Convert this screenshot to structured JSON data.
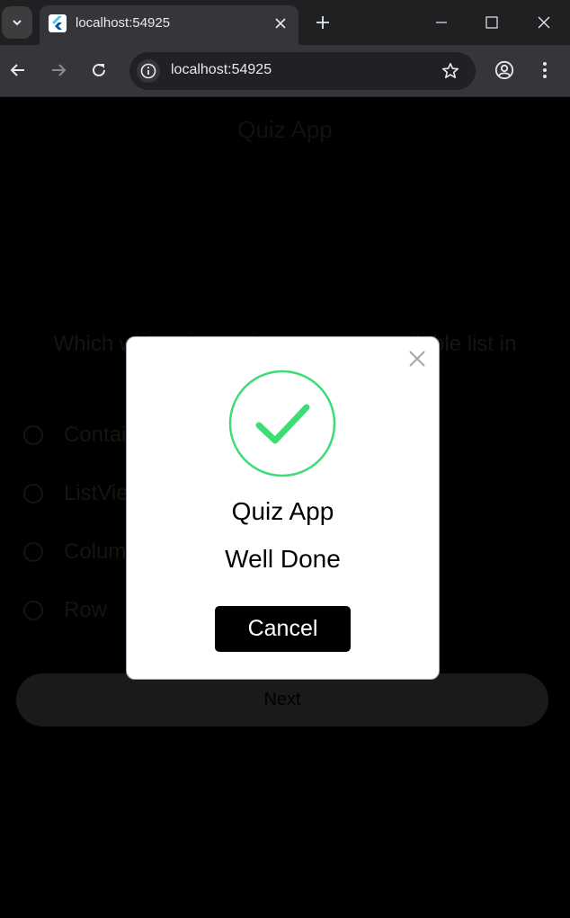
{
  "browser": {
    "tab_title": "localhost:54925",
    "url": "localhost:54925"
  },
  "app": {
    "title": "Quiz App",
    "question": "Which widget is used to create a scrollable list in",
    "options": [
      "Container",
      "ListView",
      "Column",
      "Row"
    ],
    "next_label": "Next"
  },
  "dialog": {
    "icon": "check-circle-icon",
    "title": "Quiz App",
    "message": "Well Done",
    "cancel_label": "Cancel",
    "accent_color": "#3ddc74"
  },
  "colors": {
    "chrome_bg": "#1f2021",
    "toolbar_bg": "#35363a",
    "page_bg": "#000000",
    "button_bg": "#000000"
  }
}
